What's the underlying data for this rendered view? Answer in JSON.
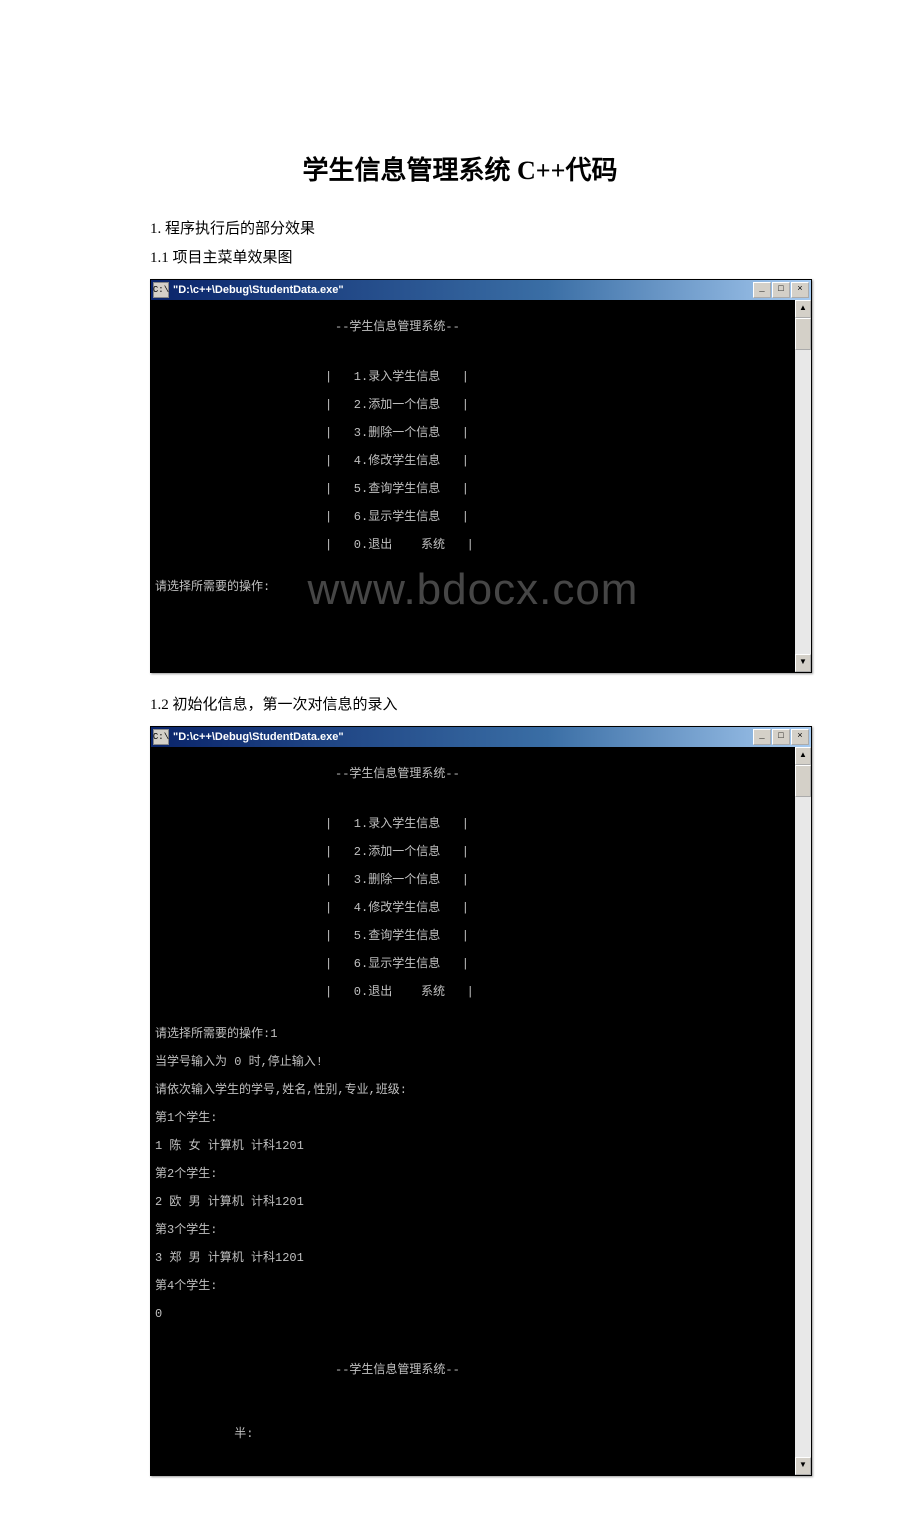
{
  "doc": {
    "title": "学生信息管理系统 C++代码",
    "section1": "1. 程序执行后的部分效果",
    "section1_1": "1.1 项目主菜单效果图",
    "section1_2": "1.2 初始化信息，第一次对信息的录入"
  },
  "window": {
    "title": "\"D:\\c++\\Debug\\StudentData.exe\"",
    "icon_glyph": "C:\\",
    "min_glyph": "_",
    "max_glyph": "□",
    "close_glyph": "×",
    "scroll_up": "▲",
    "scroll_down": "▼"
  },
  "menu": {
    "header": "--学生信息管理系统--",
    "items": [
      "|   1.录入学生信息   |",
      "|   2.添加一个信息   |",
      "|   3.删除一个信息   |",
      "|   4.修改学生信息   |",
      "|   5.查询学生信息   |",
      "|   6.显示学生信息   |",
      "|   0.退出    系统   |"
    ],
    "prompt": "请选择所需要的操作:"
  },
  "input_session": {
    "prompt_with_choice": "请选择所需要的操作:1",
    "stop_hint": "当学号输入为 0 时,停止输入!",
    "input_hint": "请依次输入学生的学号,姓名,性别,专业,班级:",
    "students": [
      {
        "header": "第1个学生:",
        "line": "1 陈 女 计算机 计科1201"
      },
      {
        "header": "第2个学生:",
        "line": "2 欧 男 计算机 计科1201"
      },
      {
        "header": "第3个学生:",
        "line": "3 郑 男 计算机 计科1201"
      },
      {
        "header": "第4个学生:",
        "line": "0"
      }
    ],
    "footer_caret": "           半:"
  },
  "watermark": "www.bdocx.com"
}
